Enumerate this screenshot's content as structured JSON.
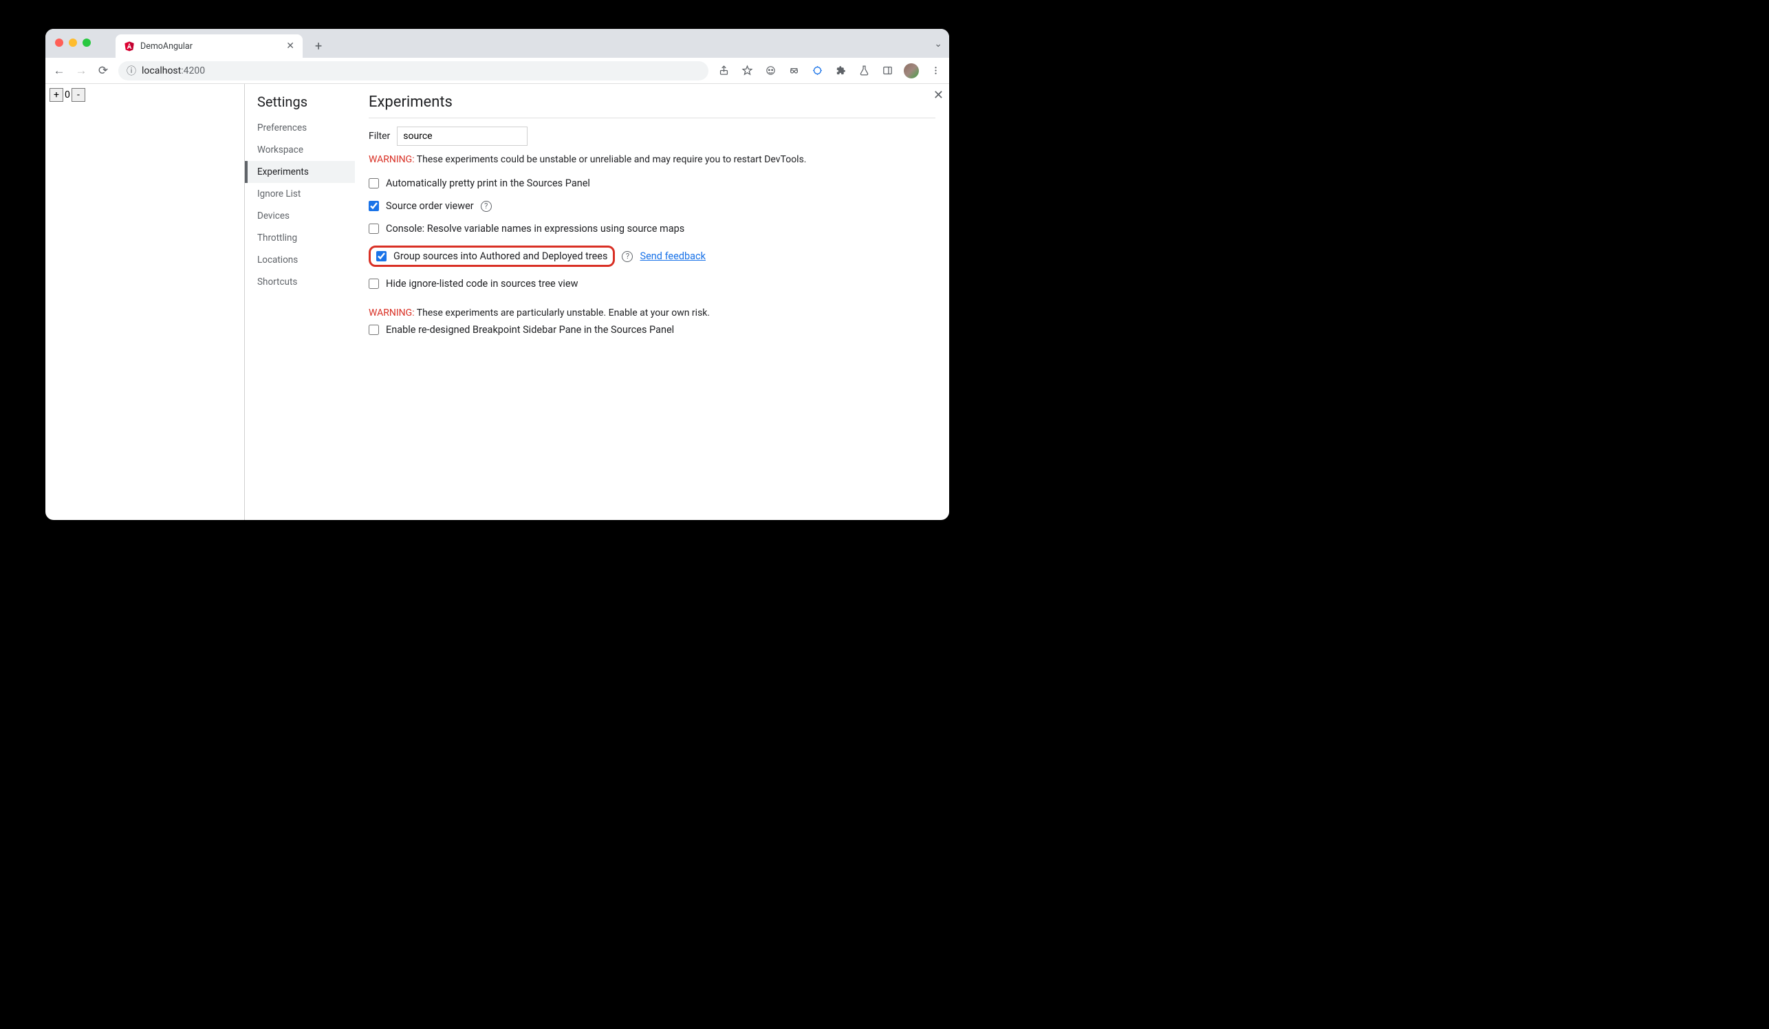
{
  "tab": {
    "title": "DemoAngular"
  },
  "address": {
    "host": "localhost",
    "port": ":4200"
  },
  "page": {
    "counter_value": "0",
    "plus": "+",
    "minus": "-"
  },
  "settings_title": "Settings",
  "sidebar": {
    "items": [
      {
        "label": "Preferences"
      },
      {
        "label": "Workspace"
      },
      {
        "label": "Experiments"
      },
      {
        "label": "Ignore List"
      },
      {
        "label": "Devices"
      },
      {
        "label": "Throttling"
      },
      {
        "label": "Locations"
      },
      {
        "label": "Shortcuts"
      }
    ]
  },
  "panel": {
    "title": "Experiments",
    "filter_label": "Filter",
    "filter_value": "source",
    "warning1_label": "WARNING:",
    "warning1_text": " These experiments could be unstable or unreliable and may require you to restart DevTools.",
    "options": [
      {
        "label": "Automatically pretty print in the Sources Panel",
        "checked": false
      },
      {
        "label": "Source order viewer",
        "checked": true,
        "help": true
      },
      {
        "label": "Console: Resolve variable names in expressions using source maps",
        "checked": false
      },
      {
        "label": "Group sources into Authored and Deployed trees",
        "checked": true,
        "help": true,
        "feedback": "Send feedback",
        "highlight": true
      },
      {
        "label": "Hide ignore-listed code in sources tree view",
        "checked": false
      }
    ],
    "warning2_label": "WARNING:",
    "warning2_text": " These experiments are particularly unstable. Enable at your own risk.",
    "options2": [
      {
        "label": "Enable re-designed Breakpoint Sidebar Pane in the Sources Panel",
        "checked": false
      }
    ]
  }
}
